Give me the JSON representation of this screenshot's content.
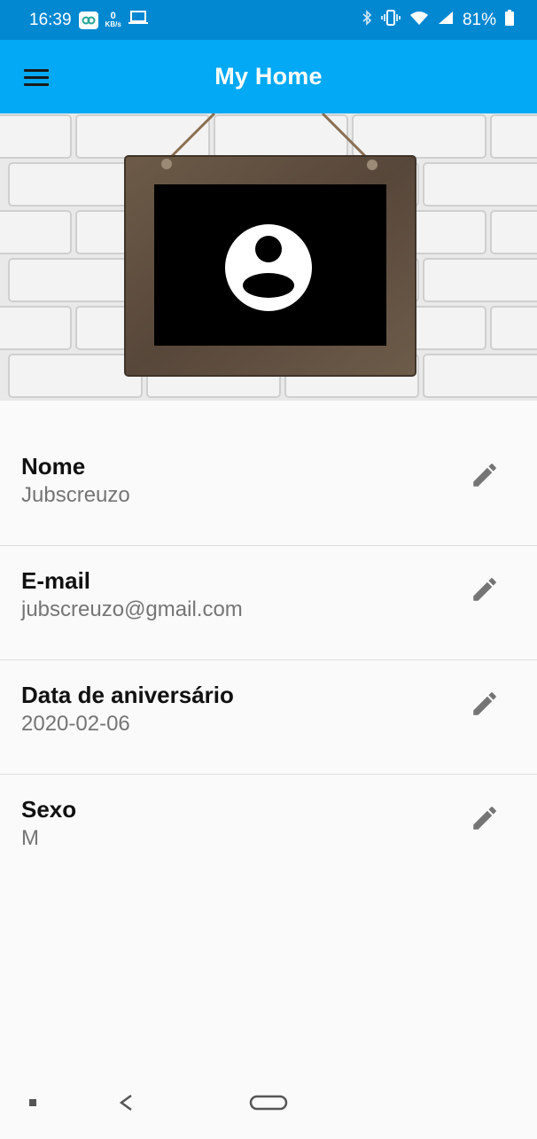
{
  "status_bar": {
    "time": "16:39",
    "net_speed_value": "0",
    "net_speed_unit": "KB/s",
    "battery": "81%"
  },
  "app_bar": {
    "title": "My Home",
    "menu_icon": "menu-icon"
  },
  "profile": {
    "fields": [
      {
        "label": "Nome",
        "value": "Jubscreuzo",
        "icon": "edit-icon"
      },
      {
        "label": "E-mail",
        "value": "jubscreuzo@gmail.com",
        "icon": "edit-icon"
      },
      {
        "label": "Data de aniversário",
        "value": "2020-02-06",
        "icon": "edit-icon"
      },
      {
        "label": "Sexo",
        "value": "M",
        "icon": "edit-icon"
      }
    ]
  },
  "colors": {
    "status_bar": "#0288d1",
    "app_bar": "#03a9f4",
    "background": "#fafafa",
    "value_text": "#757575"
  }
}
